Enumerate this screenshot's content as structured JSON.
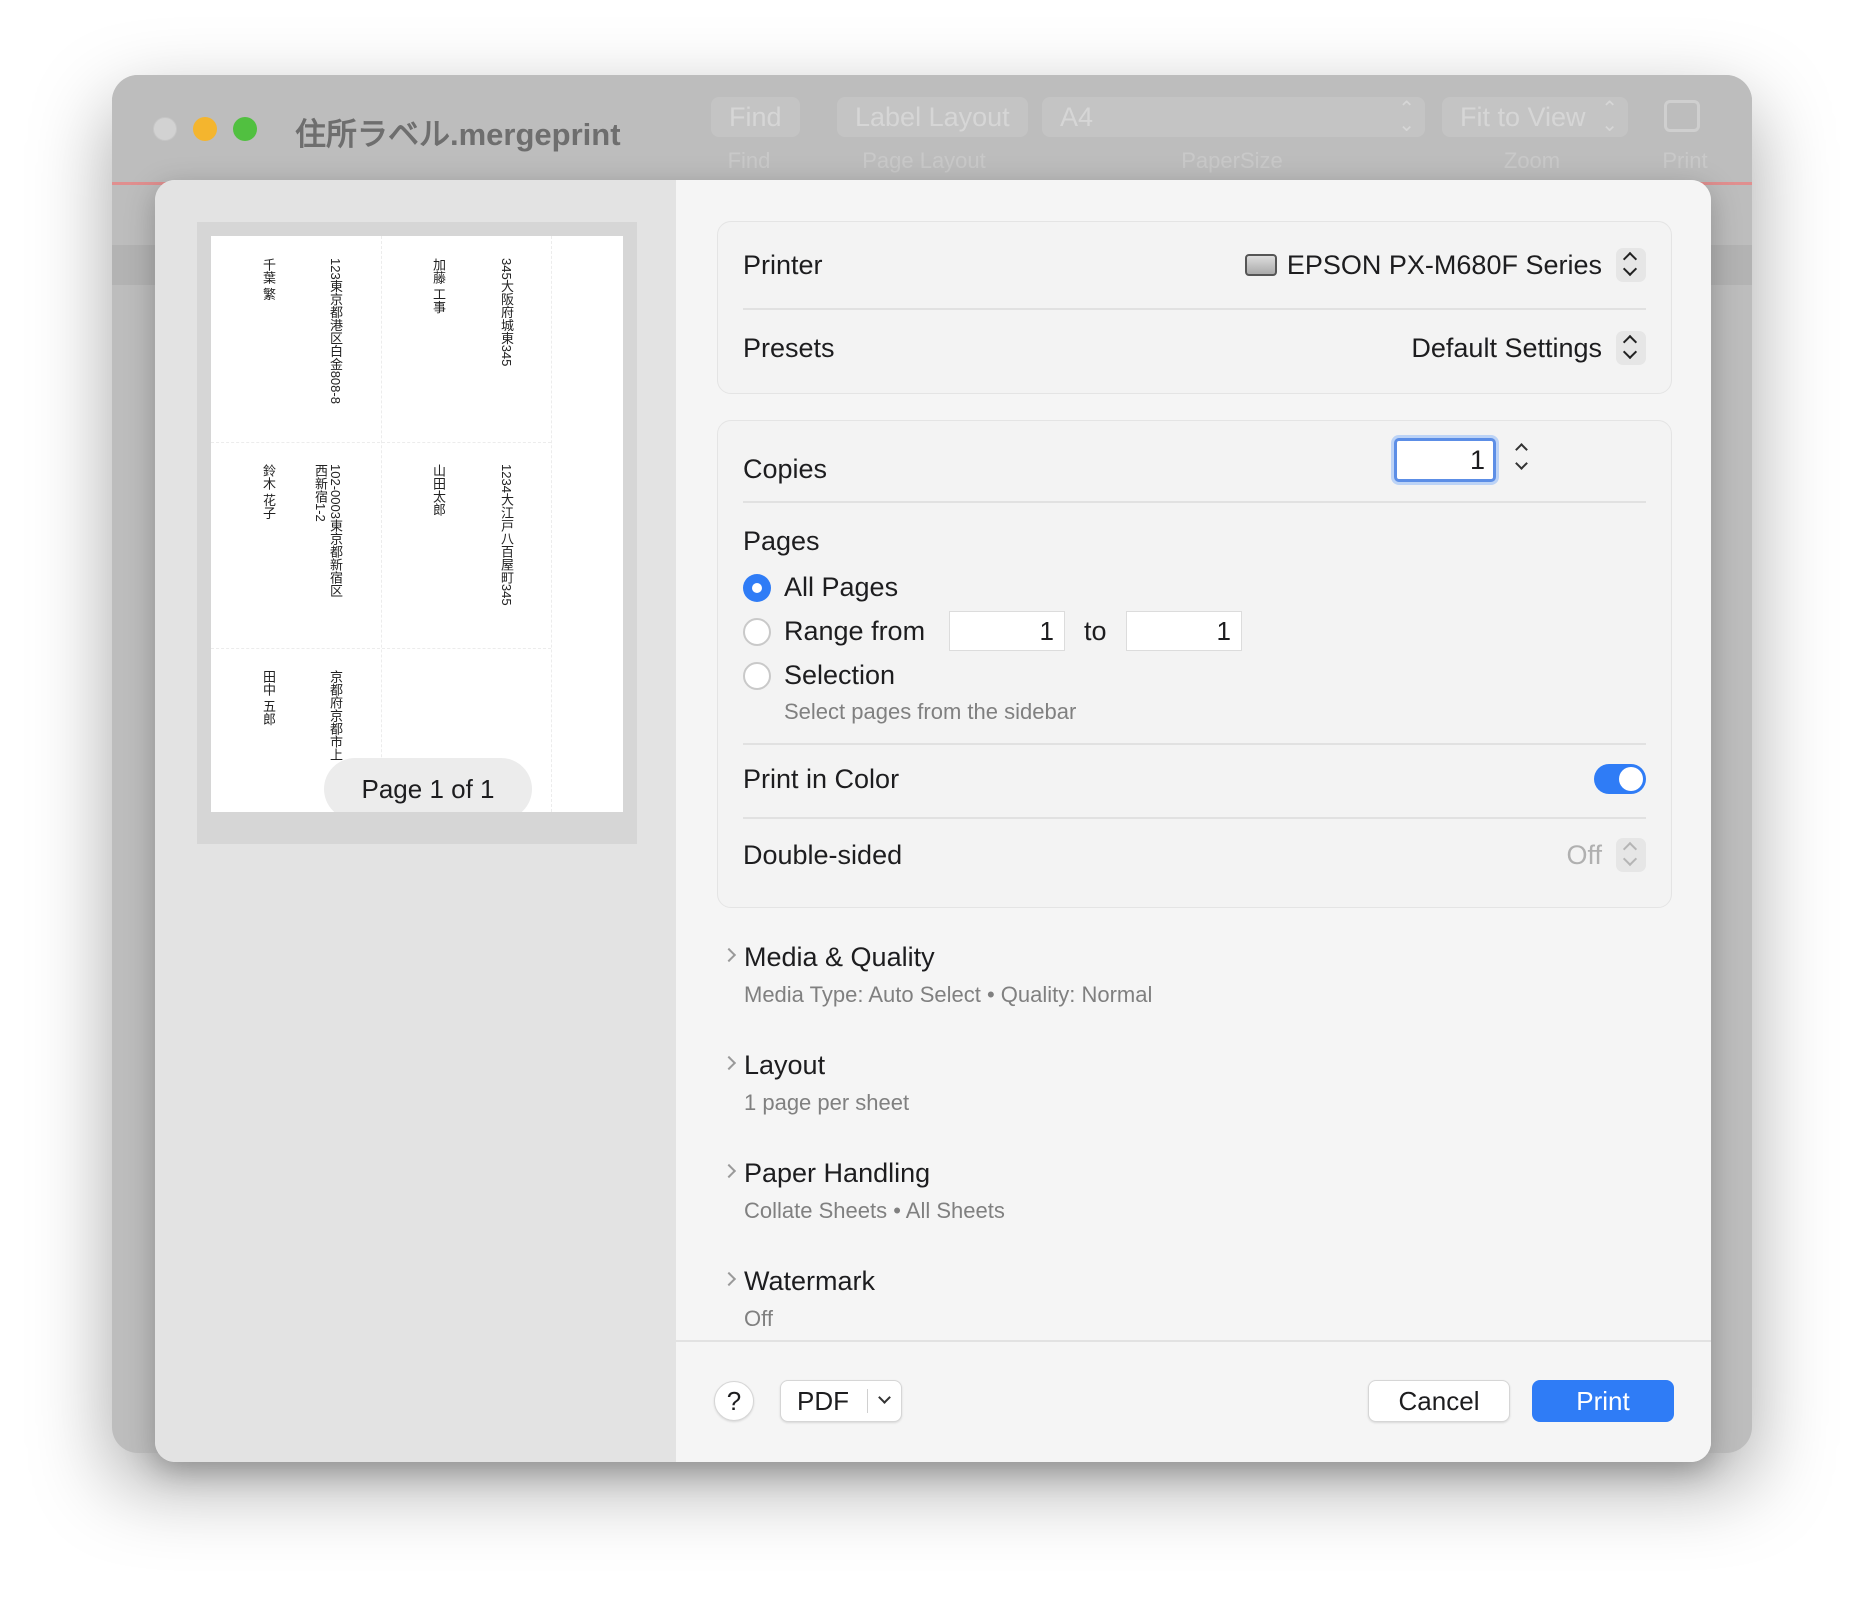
{
  "window": {
    "title": "住所ラベル.mergeprint",
    "toolbar": {
      "find_label": "Find",
      "find_caption": "Find",
      "layout_label": "Label Layout",
      "layout_caption": "Page Layout",
      "papersize_value": "A4",
      "papersize_caption": "PaperSize",
      "zoom_value": "Fit to View",
      "zoom_caption": "Zoom",
      "print_caption": "Print"
    }
  },
  "preview": {
    "page_indicator": "Page 1 of 1",
    "labels": [
      {
        "name": "千葉 繁",
        "address": "123東京都港区白金808-8"
      },
      {
        "name": "加藤 工事",
        "address": "345大阪府城東345"
      },
      {
        "name": "鈴木 花子",
        "address": "102-0003東京都新宿区",
        "address2": "西新宿1-2"
      },
      {
        "name": "山田太郎",
        "address": "1234大江戸八百屋町345"
      },
      {
        "name": "田中 五郎",
        "address": "京都府京都市上"
      }
    ]
  },
  "printer": {
    "label": "Printer",
    "value": "EPSON PX-M680F Series",
    "presets_label": "Presets",
    "presets_value": "Default Settings"
  },
  "copies": {
    "label": "Copies",
    "value": "1"
  },
  "pages": {
    "label": "Pages",
    "all_label": "All Pages",
    "range_label": "Range from",
    "range_from": "1",
    "range_to_label": "to",
    "range_to": "1",
    "selection_label": "Selection",
    "selection_hint": "Select pages from the sidebar"
  },
  "color": {
    "label": "Print in Color"
  },
  "duplex": {
    "label": "Double-sided",
    "value": "Off"
  },
  "sections": [
    {
      "title": "Media & Quality",
      "subtitle": "Media Type: Auto Select • Quality: Normal"
    },
    {
      "title": "Layout",
      "subtitle": "1 page per sheet"
    },
    {
      "title": "Paper Handling",
      "subtitle": "Collate Sheets • All Sheets"
    },
    {
      "title": "Watermark",
      "subtitle": "Off"
    }
  ],
  "footer": {
    "help_label": "?",
    "pdf_label": "PDF",
    "cancel_label": "Cancel",
    "print_label": "Print"
  },
  "colors": {
    "accent": "#2f7cf6",
    "close": "#d2d2d2",
    "minimize": "#f4b52e",
    "maximize": "#51c040"
  }
}
